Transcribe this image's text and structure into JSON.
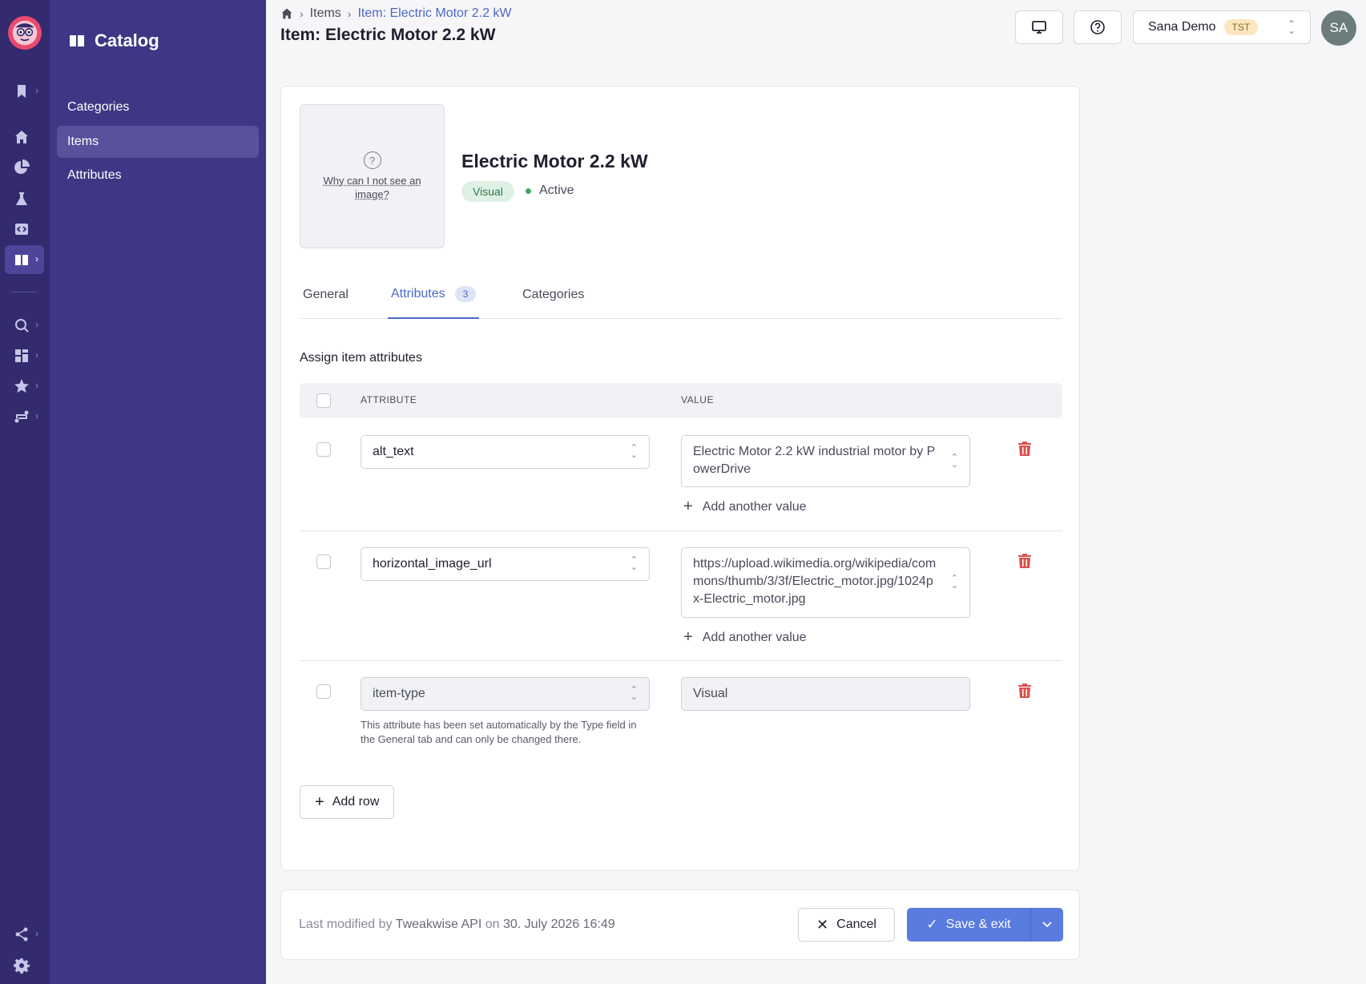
{
  "sidebar": {
    "title": "Catalog",
    "items": [
      {
        "label": "Categories"
      },
      {
        "label": "Items"
      },
      {
        "label": "Attributes"
      }
    ]
  },
  "header": {
    "breadcrumb": [
      "Items",
      "Item: Electric Motor 2.2 kW"
    ],
    "title": "Item: Electric Motor 2.2 kW",
    "workspace": "Sana Demo",
    "workspace_tag": "TST",
    "avatar_initials": "SA"
  },
  "item": {
    "image_help": "Why can I not see an image?",
    "name": "Electric Motor 2.2 kW",
    "type_badge": "Visual",
    "status": "Active"
  },
  "tabs": [
    {
      "label": "General"
    },
    {
      "label": "Attributes",
      "count": "3"
    },
    {
      "label": "Categories"
    }
  ],
  "attributes": {
    "section_title": "Assign item attributes",
    "col_attribute": "ATTRIBUTE",
    "col_value": "VALUE",
    "add_value_label": "Add another value",
    "rows": [
      {
        "attribute": "alt_text",
        "value": "Electric Motor 2.2 kW industrial motor by PowerDrive"
      },
      {
        "attribute": "horizontal_image_url",
        "value": "https://upload.wikimedia.org/wikipedia/commons/thumb/3/3f/Electric_motor.jpg/1024px-Electric_motor.jpg"
      },
      {
        "attribute": "item-type",
        "value": "Visual",
        "hint": "This attribute has been set automatically by the Type field in the General tab and can only be changed there."
      }
    ],
    "add_row_label": "Add row"
  },
  "footer": {
    "modified_prefix": "Last modified by",
    "modified_by": "Tweakwise API",
    "modified_on_word": "on",
    "modified_date": "30. July 2026 16:49",
    "cancel_label": "Cancel",
    "save_label": "Save & exit"
  },
  "colors": {
    "rail": "#332b6e",
    "sidebar": "#3f3785",
    "accent": "#4c68c4",
    "primary_button": "#5a7be0",
    "danger": "#d9534f",
    "active_status": "#3caa5e"
  }
}
